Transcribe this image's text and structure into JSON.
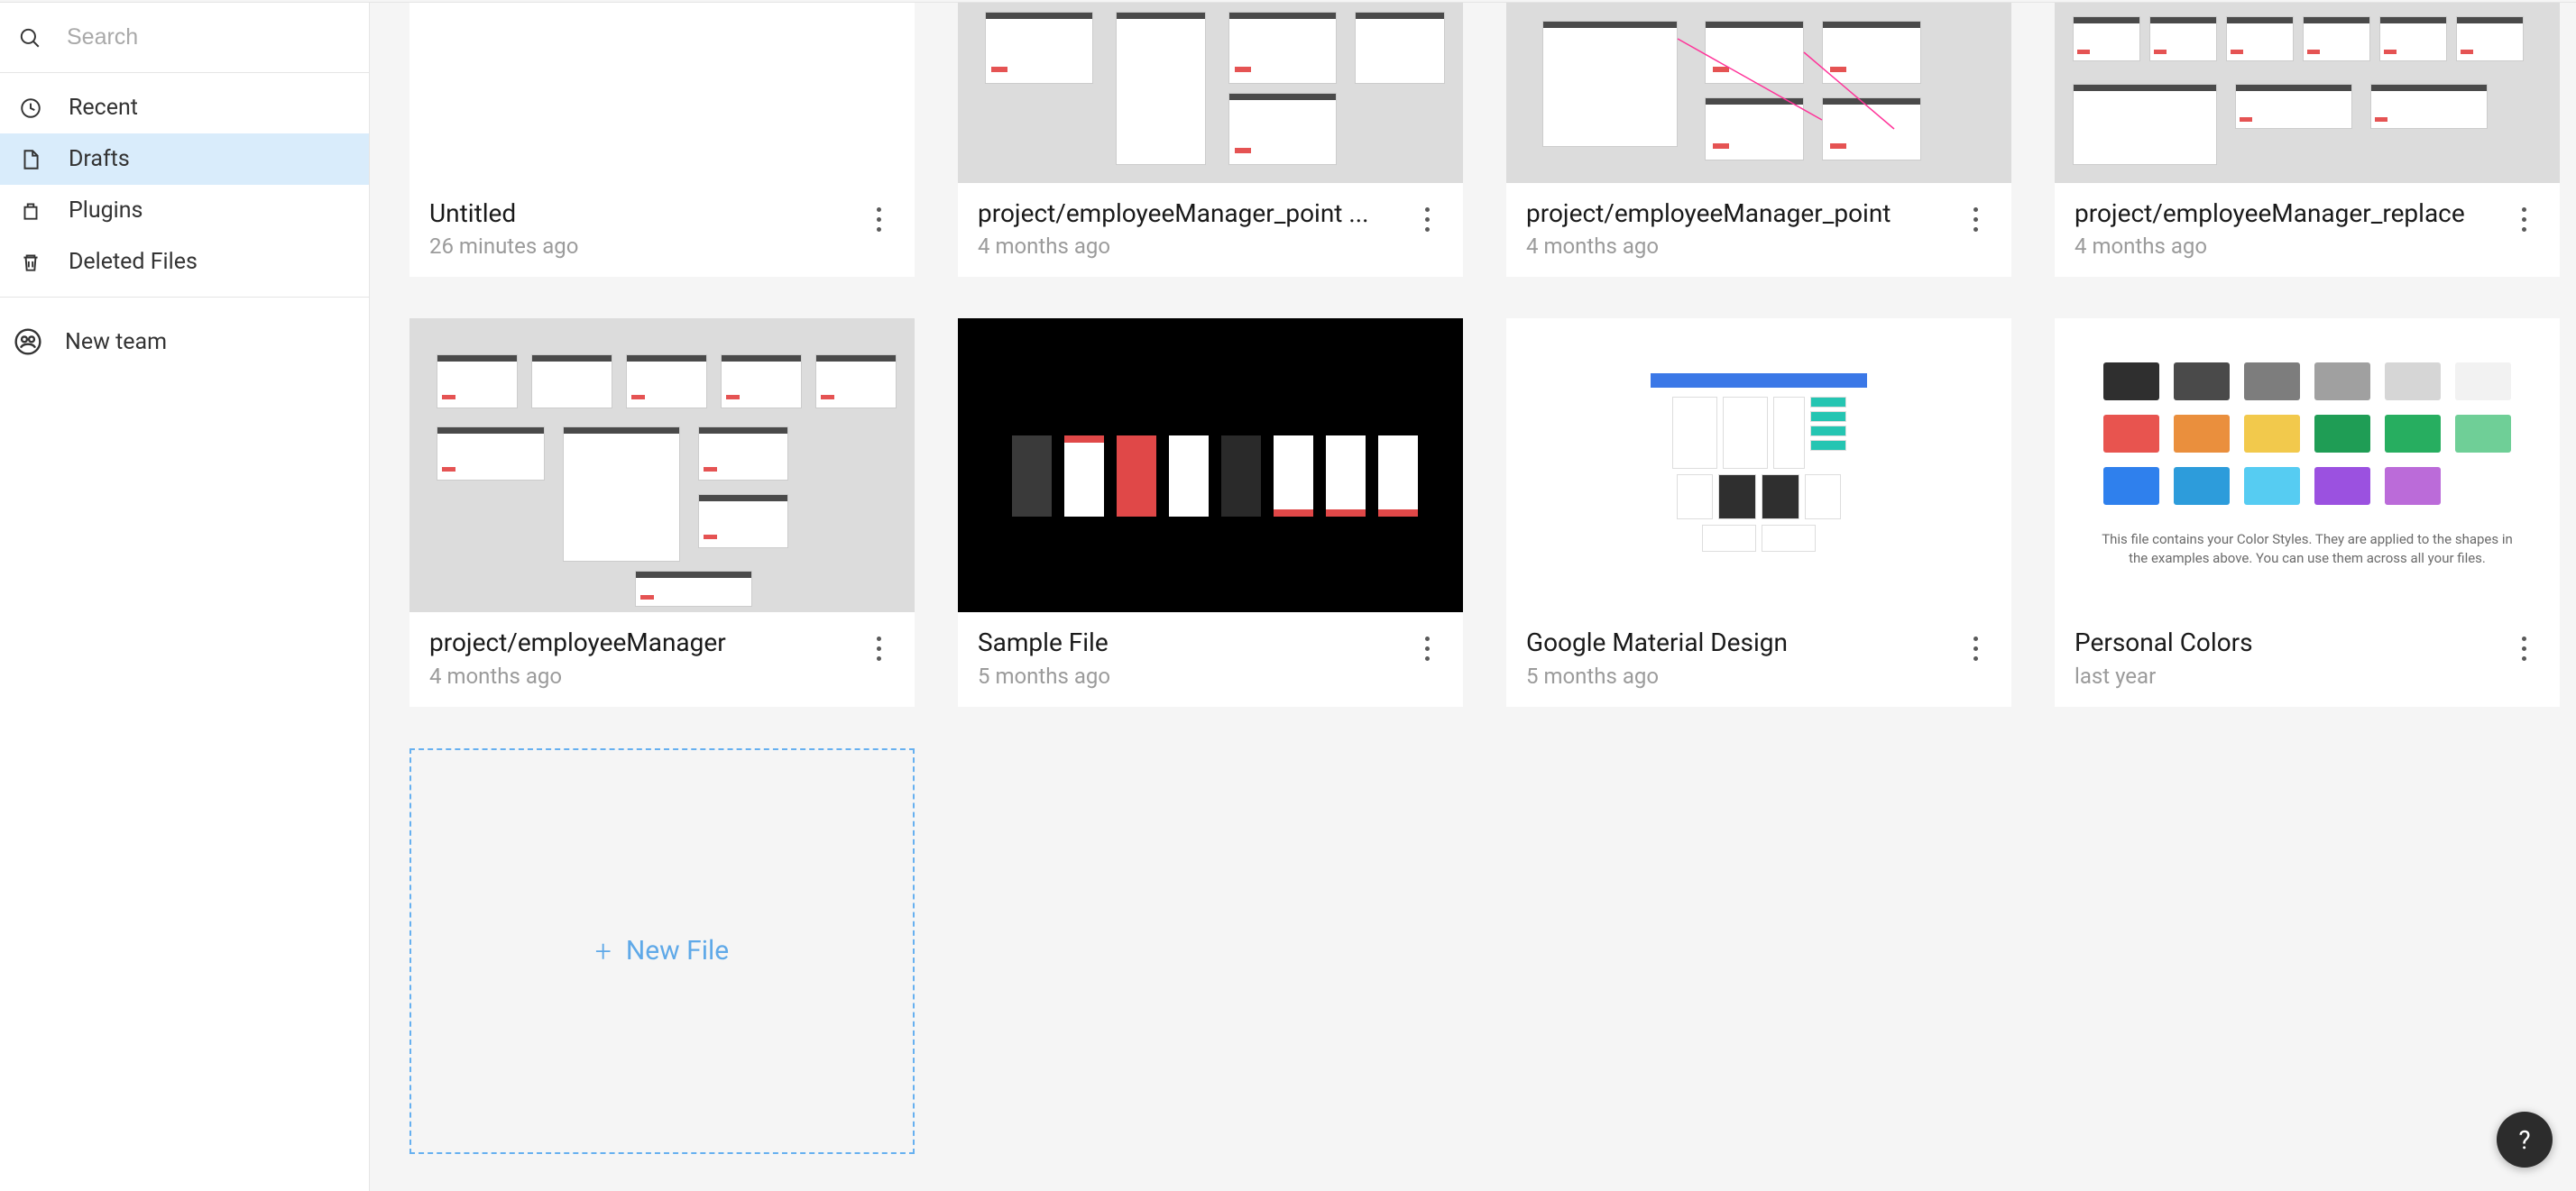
{
  "search": {
    "placeholder": "Search"
  },
  "sidebar": {
    "items": [
      {
        "label": "Recent",
        "icon": "clock-icon",
        "active": false
      },
      {
        "label": "Drafts",
        "icon": "file-icon",
        "active": true
      },
      {
        "label": "Plugins",
        "icon": "plugin-icon",
        "active": false
      },
      {
        "label": "Deleted Files",
        "icon": "trash-icon",
        "active": false
      }
    ],
    "new_team_label": "New team"
  },
  "files": [
    {
      "title": "Untitled",
      "time": "26 minutes ago",
      "thumb_type": "white"
    },
    {
      "title": "project/employeeManager_point ...",
      "time": "4 months ago",
      "thumb_type": "wireframes-a"
    },
    {
      "title": "project/employeeManager_point",
      "time": "4 months ago",
      "thumb_type": "wireframes-b"
    },
    {
      "title": "project/employeeManager_replace",
      "time": "4 months ago",
      "thumb_type": "wireframes-c"
    },
    {
      "title": "project/employeeManager",
      "time": "4 months ago",
      "thumb_type": "wireframes-d"
    },
    {
      "title": "Sample File",
      "time": "5 months ago",
      "thumb_type": "black-phones"
    },
    {
      "title": "Google Material Design",
      "time": "5 months ago",
      "thumb_type": "gmd"
    },
    {
      "title": "Personal Colors",
      "time": "last year",
      "thumb_type": "colors"
    }
  ],
  "new_file_label": "New File",
  "colors_caption": "This file contains your Color Styles. They are applied to the shapes in the examples above. You can use them across all your files.",
  "color_swatches": [
    "#2f2f2f",
    "#4a4a4a",
    "#7d7d7d",
    "#a0a0a0",
    "#d6d6d6",
    "#f2f2f2",
    "#e8544f",
    "#ea8f3d",
    "#f2c94c",
    "#1f9d55",
    "#27ae60",
    "#6fcf97",
    "#2f80ed",
    "#2d9cdb",
    "#56ccf2",
    "#9b51e0",
    "#bb6bd9"
  ],
  "help_label": "?"
}
